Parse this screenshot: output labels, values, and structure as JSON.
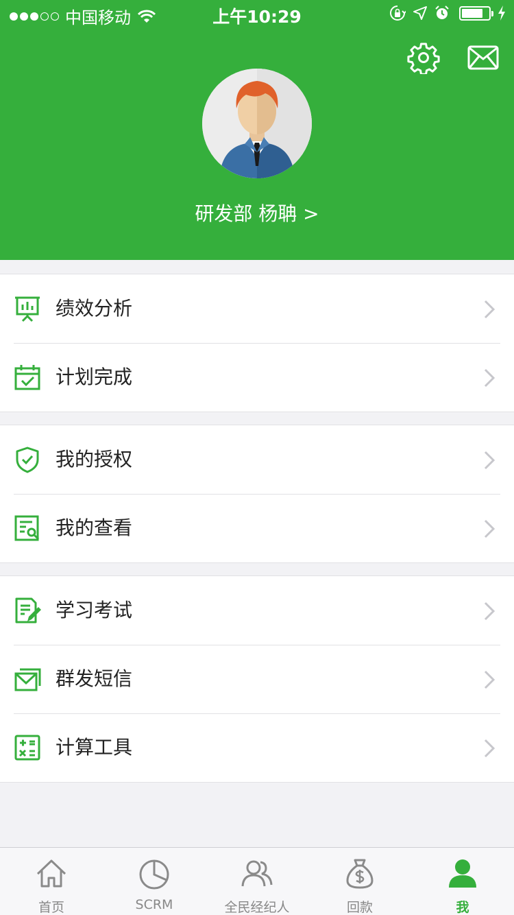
{
  "status_bar": {
    "carrier": "中国移动",
    "time": "上午10:29",
    "signal_bars": 3,
    "signal_total": 5,
    "battery_level": 0.8
  },
  "header": {
    "profile_name": "研发部 杨聃 >",
    "settings_icon": "gear-icon",
    "mail_icon": "envelope-icon"
  },
  "menu_groups": [
    [
      {
        "label": "绩效分析",
        "icon": "presentation-chart-icon"
      },
      {
        "label": "计划完成",
        "icon": "calendar-check-icon"
      }
    ],
    [
      {
        "label": "我的授权",
        "icon": "shield-check-icon"
      },
      {
        "label": "我的查看",
        "icon": "document-search-icon"
      }
    ],
    [
      {
        "label": "学习考试",
        "icon": "exam-edit-icon"
      },
      {
        "label": "群发短信",
        "icon": "mail-stack-icon"
      },
      {
        "label": "计算工具",
        "icon": "calculator-icon"
      }
    ]
  ],
  "tabs": [
    {
      "label": "首页",
      "icon": "home-icon",
      "active": false
    },
    {
      "label": "SCRM",
      "icon": "pie-chart-icon",
      "active": false
    },
    {
      "label": "全民经纪人",
      "icon": "users-icon",
      "active": false
    },
    {
      "label": "回款",
      "icon": "money-bag-icon",
      "active": false
    },
    {
      "label": "我",
      "icon": "user-icon",
      "active": true
    }
  ],
  "colors": {
    "brand_green": "#35af3c",
    "background": "#f2f2f5",
    "tab_inactive": "#888888"
  }
}
